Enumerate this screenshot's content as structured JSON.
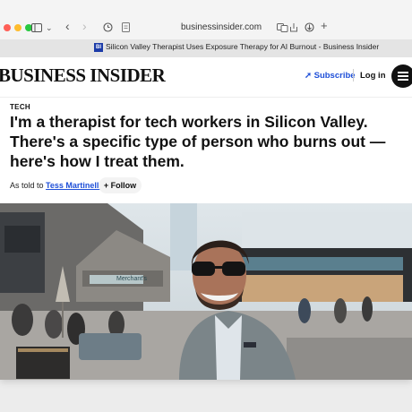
{
  "browser": {
    "url": "businessinsider.com",
    "tab_title": "Silicon Valley Therapist Uses Exposure Therapy for AI Burnout - Business Insider",
    "tab_favicon": "BI"
  },
  "site": {
    "logo": "BUSINESS INSIDER",
    "subscribe_icon": "arrow-up-right-icon",
    "subscribe_label": "Subscribe",
    "login_label": "Log in",
    "menu_icon": "hamburger-icon",
    "accent_color": "#1e4fd8"
  },
  "article": {
    "kicker": "TECH",
    "headline": "I'm a therapist for tech workers in Silicon Valley. There's a specific type of person who burns out — here's how I treat them.",
    "byline_prefix": "As told to",
    "author": "Tess Martinelli",
    "follow_label": "+ Follow"
  },
  "photo": {
    "signage": "Merchant's"
  }
}
